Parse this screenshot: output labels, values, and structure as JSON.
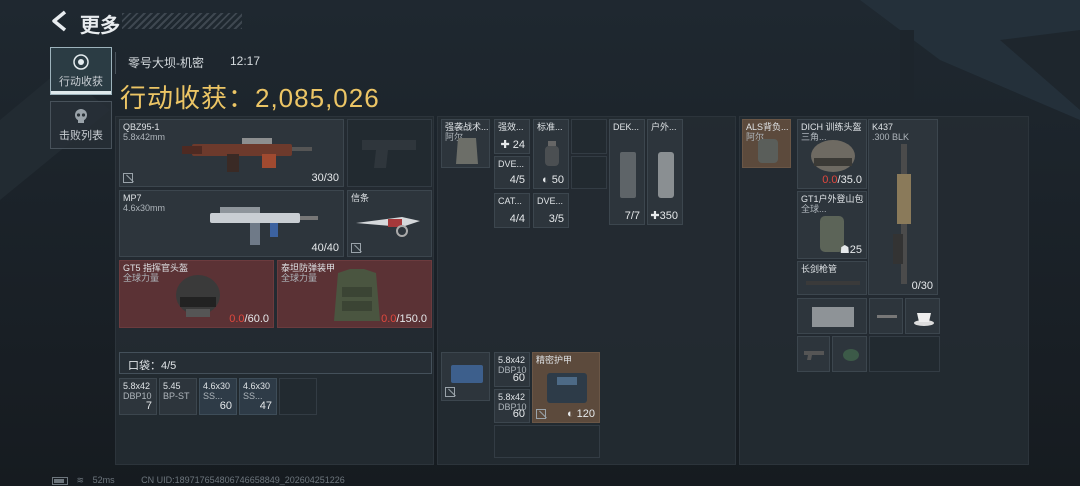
{
  "header": {
    "title": "更多"
  },
  "sidebar": {
    "tabs": [
      {
        "label": "行动收获",
        "active": true
      },
      {
        "label": "击败列表",
        "active": false
      }
    ]
  },
  "session": {
    "map": "零号大坝-机密",
    "time": "12:17"
  },
  "loot": {
    "label": "行动收获：2,085,026"
  },
  "weapons": {
    "primary": {
      "name": "QBZ95-1",
      "ammo_type": "5.8x42mm",
      "ammo": "30/30"
    },
    "secondary": {
      "name": "MP7",
      "ammo_type": "4.6x30mm",
      "ammo": "40/40"
    },
    "melee": {
      "name": "信条"
    },
    "pistol_slot": {
      "empty": true
    }
  },
  "gear": {
    "helmet": {
      "name": "GT5 指挥官头盔",
      "brand": "全球力量",
      "dur_current": "0.0",
      "dur_max": "/60.0"
    },
    "armor": {
      "name": "泰坦防弹装甲",
      "brand": "全球力量",
      "dur_current": "0.0",
      "dur_max": "/150.0"
    }
  },
  "pocket": {
    "label": "口袋：4/5",
    "items": [
      {
        "cal": "5.8x42",
        "type": "DBP10",
        "count": "7"
      },
      {
        "cal": "5.45",
        "type": "BP-ST",
        "count": ""
      },
      {
        "cal": "4.6x30",
        "type": "SS...",
        "count": "60"
      },
      {
        "cal": "4.6x30",
        "type": "SS...",
        "count": "47"
      }
    ]
  },
  "rig": {
    "vest": {
      "name": "强袭战术...",
      "name2": "阿尔..."
    },
    "items": {
      "stim": {
        "name": "强效...",
        "count": "24"
      },
      "grenade": {
        "name": "标准...",
        "count": "50"
      },
      "dve1": {
        "name": "DVE...",
        "count": "4/5"
      },
      "cat": {
        "name": "CAT...",
        "count": "4/4"
      },
      "dve2": {
        "name": "DVE...",
        "count": "3/5"
      },
      "dek": {
        "name": "DEK...",
        "count": "7/7"
      },
      "outdoor": {
        "name": "户外...",
        "count": "350"
      }
    }
  },
  "backpack": {
    "ammo1": {
      "cal": "5.8x42",
      "type": "DBP10",
      "count": "60"
    },
    "ammo2": {
      "cal": "5.8x42",
      "type": "DBP10",
      "count": "60"
    },
    "armor": {
      "name": "精密护甲",
      "count": "120"
    }
  },
  "right": {
    "bag": {
      "name": "ALS背负...",
      "name2": "阿尔..."
    },
    "helmet": {
      "name": "DICH 训练头盔",
      "name2": "三角...",
      "dur_current": "0.0",
      "dur_max": "/35.0"
    },
    "backpack2": {
      "name": "GT1户外登山包",
      "name2": "全球...",
      "count": "25"
    },
    "rifle": {
      "name": "K437",
      "ammo_type": ".300 BLK",
      "ammo": "0/30"
    },
    "barrel": {
      "name": "长剑枪管"
    }
  },
  "footer": {
    "ping": "52ms",
    "uid": "CN UID:189717654806746658849_202604251226"
  },
  "colors": {
    "loot_gold": "#ecc565",
    "durability_red": "#e0483e",
    "gear_red": "#5b3235"
  }
}
